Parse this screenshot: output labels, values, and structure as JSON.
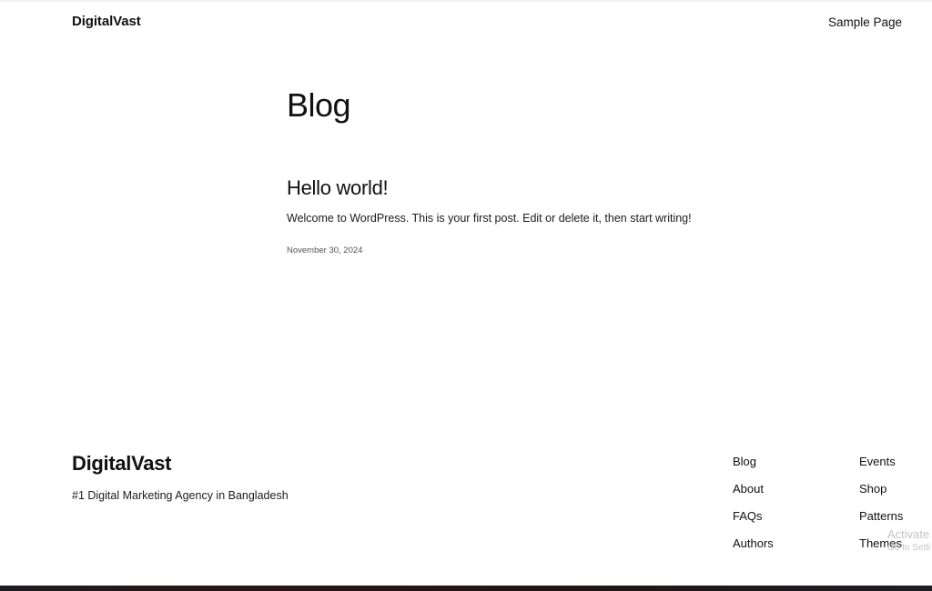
{
  "header": {
    "site_title": "DigitalVast",
    "nav": [
      {
        "label": "Sample Page"
      }
    ]
  },
  "main": {
    "heading": "Blog",
    "posts": [
      {
        "title": "Hello world!",
        "excerpt": "Welcome to WordPress. This is your first post. Edit or delete it, then start writing!",
        "date": "November 30, 2024"
      }
    ]
  },
  "footer": {
    "site_title": "DigitalVast",
    "tagline": "#1 Digital Marketing Agency in Bangladesh",
    "nav_col1": [
      {
        "label": "Blog"
      },
      {
        "label": "About"
      },
      {
        "label": "FAQs"
      },
      {
        "label": "Authors"
      }
    ],
    "nav_col2": [
      {
        "label": "Events"
      },
      {
        "label": "Shop"
      },
      {
        "label": "Patterns"
      },
      {
        "label": "Themes"
      }
    ]
  },
  "watermark": {
    "line1": "Activate",
    "line2": "Go to Setti"
  }
}
